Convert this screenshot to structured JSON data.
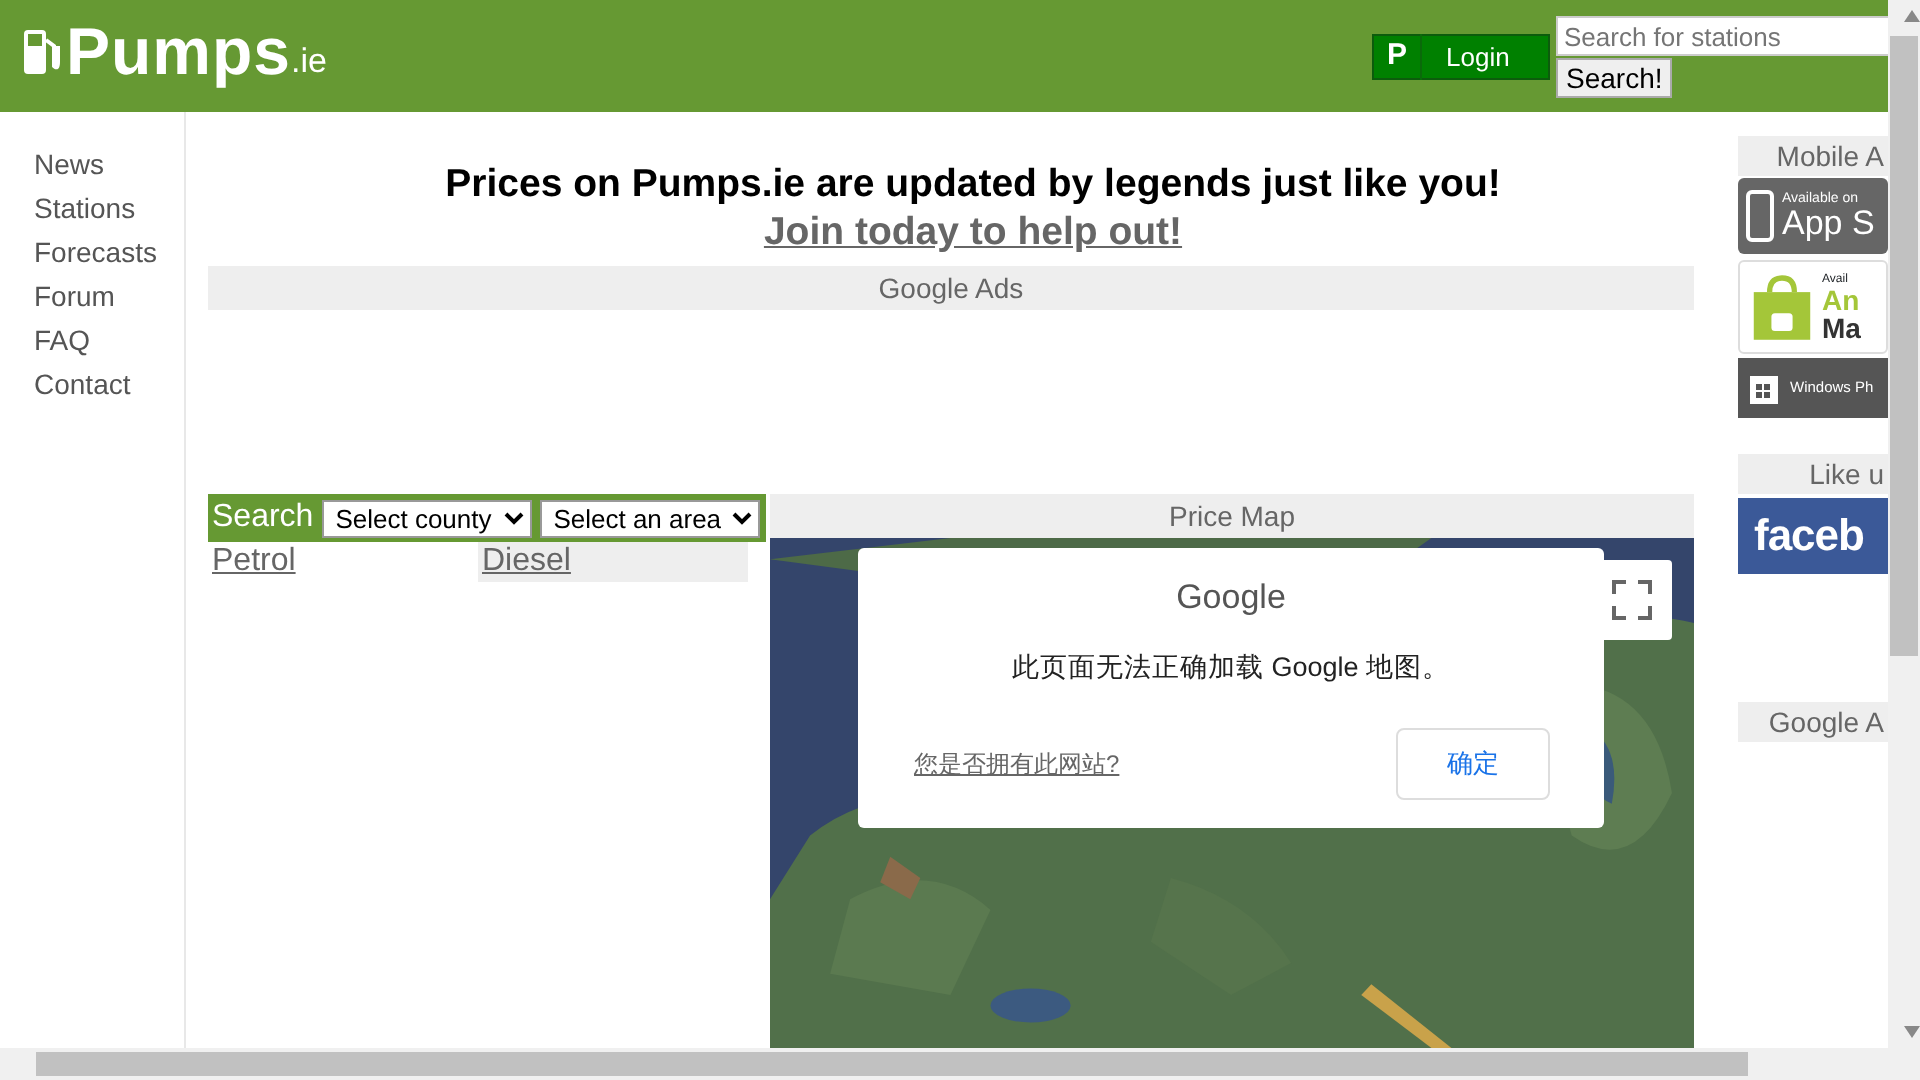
{
  "header": {
    "logo": {
      "name": "Pumps",
      "suffix": ".ie"
    },
    "login_button": {
      "icon": "P",
      "label": "Login"
    },
    "search": {
      "placeholder": "Search for stations",
      "button": "Search!"
    }
  },
  "sidebar": {
    "items": [
      {
        "label": "News"
      },
      {
        "label": "Stations"
      },
      {
        "label": "Forecasts"
      },
      {
        "label": "Forum"
      },
      {
        "label": "FAQ"
      },
      {
        "label": "Contact"
      }
    ]
  },
  "main": {
    "headline": "Prices on Pumps.ie are updated by legends just like you!",
    "join_link": "Join today to help out!",
    "ads_heading": "Google Ads",
    "search_bar": {
      "label": "Search",
      "county_select": "Select county",
      "area_select": "Select an area"
    },
    "fuel_tabs": [
      {
        "label": "Petrol",
        "selected": true
      },
      {
        "label": "Diesel",
        "selected": false
      }
    ],
    "price_map": {
      "heading": "Price Map",
      "dialog": {
        "brand": "Google",
        "message": "此页面无法正确加载 Google 地图。",
        "link": "您是否拥有此网站?",
        "button": "确定"
      }
    }
  },
  "right_column": {
    "mobile_heading": "Mobile A",
    "badges": [
      {
        "kind": "apple",
        "small": "Available on",
        "big": "App S"
      },
      {
        "kind": "android",
        "small": "Avail",
        "big": "An",
        "big2": "Ma"
      },
      {
        "kind": "windows",
        "small": "Windows Ph"
      }
    ],
    "like_heading": "Like u",
    "facebook": "faceb",
    "ads_heading": "Google A"
  }
}
